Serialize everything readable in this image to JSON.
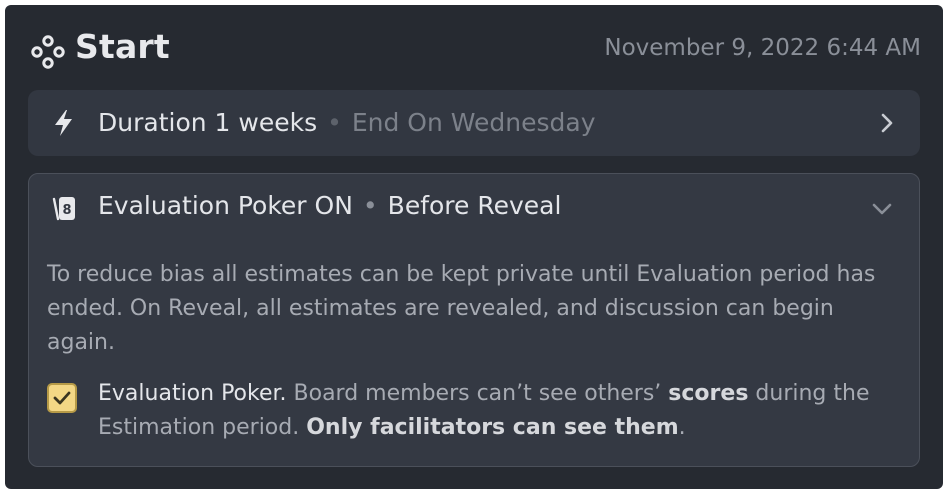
{
  "header": {
    "title": "Start",
    "icon": "stages-icon",
    "timestamp": "November 9, 2022 6:44 AM"
  },
  "duration": {
    "icon": "bolt-icon",
    "label": "Duration 1 weeks",
    "separator": "•",
    "end_label": "End On Wednesday",
    "chevron": "chevron-right-icon"
  },
  "evaluation": {
    "icon": "cards-icon",
    "icon_text": "8",
    "title": "Evaluation Poker ON",
    "separator": "•",
    "mode": "Before Reveal",
    "chevron": "chevron-down-icon",
    "description": "To reduce bias all estimates can be kept private until Evaluation period has ended. On Reveal, all estimates are revealed, and discussion can begin again.",
    "checkbox": {
      "checked": true,
      "lead": "Evaluation Poker.",
      "text_1": " Board members can’t see others’ ",
      "bold_1": "scores",
      "text_2": " during the Estimation period. ",
      "bold_2": "Only facilitators can see them",
      "text_3": "."
    }
  },
  "colors": {
    "panel_bg": "#262a31",
    "row_bg": "#323741",
    "checkbox_fill": "#f3d785"
  }
}
